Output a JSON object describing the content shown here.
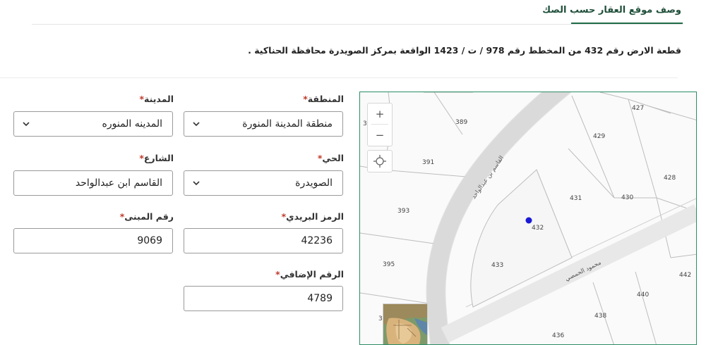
{
  "section": {
    "title": "وصف موقع العقار حسب الصك",
    "description": "قطعة الارض رقم 432 من المخطط رقم 978 / ت / 1423 الواقعة بمركز الصويدرة محافظة الحناكية ."
  },
  "form": {
    "region": {
      "label": "المنطقة",
      "required": "*",
      "value": "منطقة المدينة المنورة"
    },
    "city": {
      "label": "المدينة",
      "required": "*",
      "value": "المدينه المنوره"
    },
    "district": {
      "label": "الحي",
      "required": "*",
      "value": "الصويدرة"
    },
    "street": {
      "label": "الشارع",
      "required": "*",
      "value": "القاسم ابن عبدالواحد"
    },
    "postal_code": {
      "label": "الرمز البريدي",
      "required": "*",
      "value": "42236"
    },
    "building_number": {
      "label": "رقم المبنى",
      "required": "*",
      "value": "9069"
    },
    "additional_number": {
      "label": "الرقم الإضافي",
      "required": "*",
      "value": "4789"
    }
  },
  "map": {
    "zoom_in_label": "+",
    "zoom_out_label": "−",
    "street_labels": [
      "القاسم بن عبدالواحد",
      "محمود الحمصي"
    ],
    "parcels": [
      "427",
      "389",
      "3",
      "429",
      "391",
      "428",
      "431",
      "430",
      "393",
      "432",
      "433",
      "395",
      "442",
      "440",
      "438",
      "436",
      "3"
    ],
    "marker_color": "#1a1ad6",
    "border_color": "#2c8c66"
  },
  "colors": {
    "accent": "#1e6b47",
    "required": "#c0392b"
  }
}
